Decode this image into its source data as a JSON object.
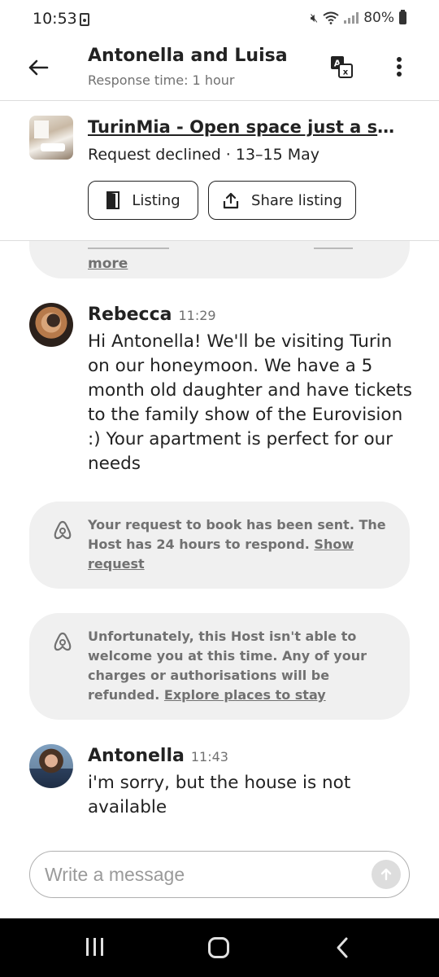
{
  "status_bar": {
    "time": "10:53",
    "battery": "80%"
  },
  "header": {
    "title": "Antonella and Luisa",
    "subtitle": "Response time: 1 hour"
  },
  "listing": {
    "title": "TurinMia - Open space just a st...",
    "status": "Request declined · 13–15 May",
    "listing_button": "Listing",
    "share_button": "Share listing"
  },
  "chat": {
    "prev_bubble_more": "more",
    "messages": [
      {
        "name": "Rebecca",
        "time": "11:29",
        "text": "Hi Antonella! We'll be visiting Turin on our honeymoon. We have a 5 month old daughter and have tickets to the family show of the Eurovision :) Your apartment is perfect for our needs"
      },
      {
        "name": "Antonella",
        "time": "11:43",
        "text": "i'm sorry, but the house is not available"
      }
    ],
    "system": [
      {
        "text": "Your request to book has been sent. The Host has 24 hours to respond.",
        "link": "Show request"
      },
      {
        "text": "Unfortunately, this Host isn't able to welcome you at this time. Any of your charges or authorisations will be refunded.",
        "link": "Explore places to stay"
      }
    ]
  },
  "composer": {
    "placeholder": "Write a message"
  },
  "icons": {
    "back": "arrow-left-icon",
    "translate": "translate-icon",
    "more": "more-vertical-icon",
    "listing": "door-icon",
    "share": "share-icon",
    "system": "airbnb-logo-icon",
    "send": "arrow-up-icon"
  }
}
